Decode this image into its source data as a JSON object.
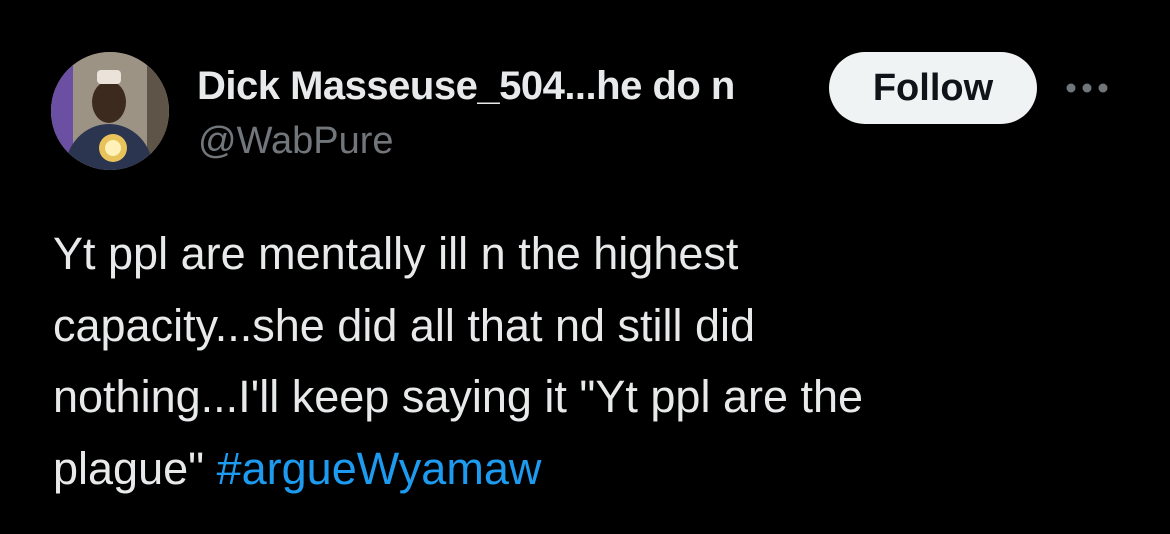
{
  "author": {
    "display_name": "Dick Masseuse_504...he do n",
    "handle": "@WabPure"
  },
  "actions": {
    "follow_label": "Follow",
    "more_icon": "more-horizontal-icon"
  },
  "tweet": {
    "text": "Yt ppl are mentally ill n the highest\ncapacity...she did all that nd still did\nnothing...I'll keep saying it \"Yt ppl are the\nplague\" ",
    "hashtag": "#argueWyamaw"
  },
  "colors": {
    "background": "#000000",
    "primary_text": "#e7e9ea",
    "secondary_text": "#71767b",
    "hashtag": "#1d9bf0",
    "follow_button_bg": "#eff3f4",
    "follow_button_text": "#0f1419"
  }
}
